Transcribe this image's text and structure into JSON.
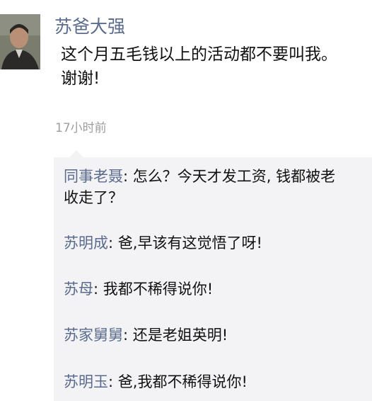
{
  "post": {
    "author": "苏爸大强",
    "text_line1": "这个月五毛钱以上的活动都不要叫我。",
    "text_line2": "谢谢!",
    "time": "17小时前"
  },
  "comments": [
    {
      "name": "同事老聂",
      "text_line1": "怎么？今天才发工资, 钱都被老",
      "text_line2": "收走了？"
    },
    {
      "name": "苏明成",
      "text": "爸,早该有这觉悟了呀!"
    },
    {
      "name": "苏母",
      "text": "我都不稀得说你!"
    },
    {
      "name": "苏家舅舅",
      "text": "还是老姐英明!"
    },
    {
      "name": "苏明玉",
      "text": "爸,我都不稀得说你!"
    }
  ],
  "separator": ": "
}
